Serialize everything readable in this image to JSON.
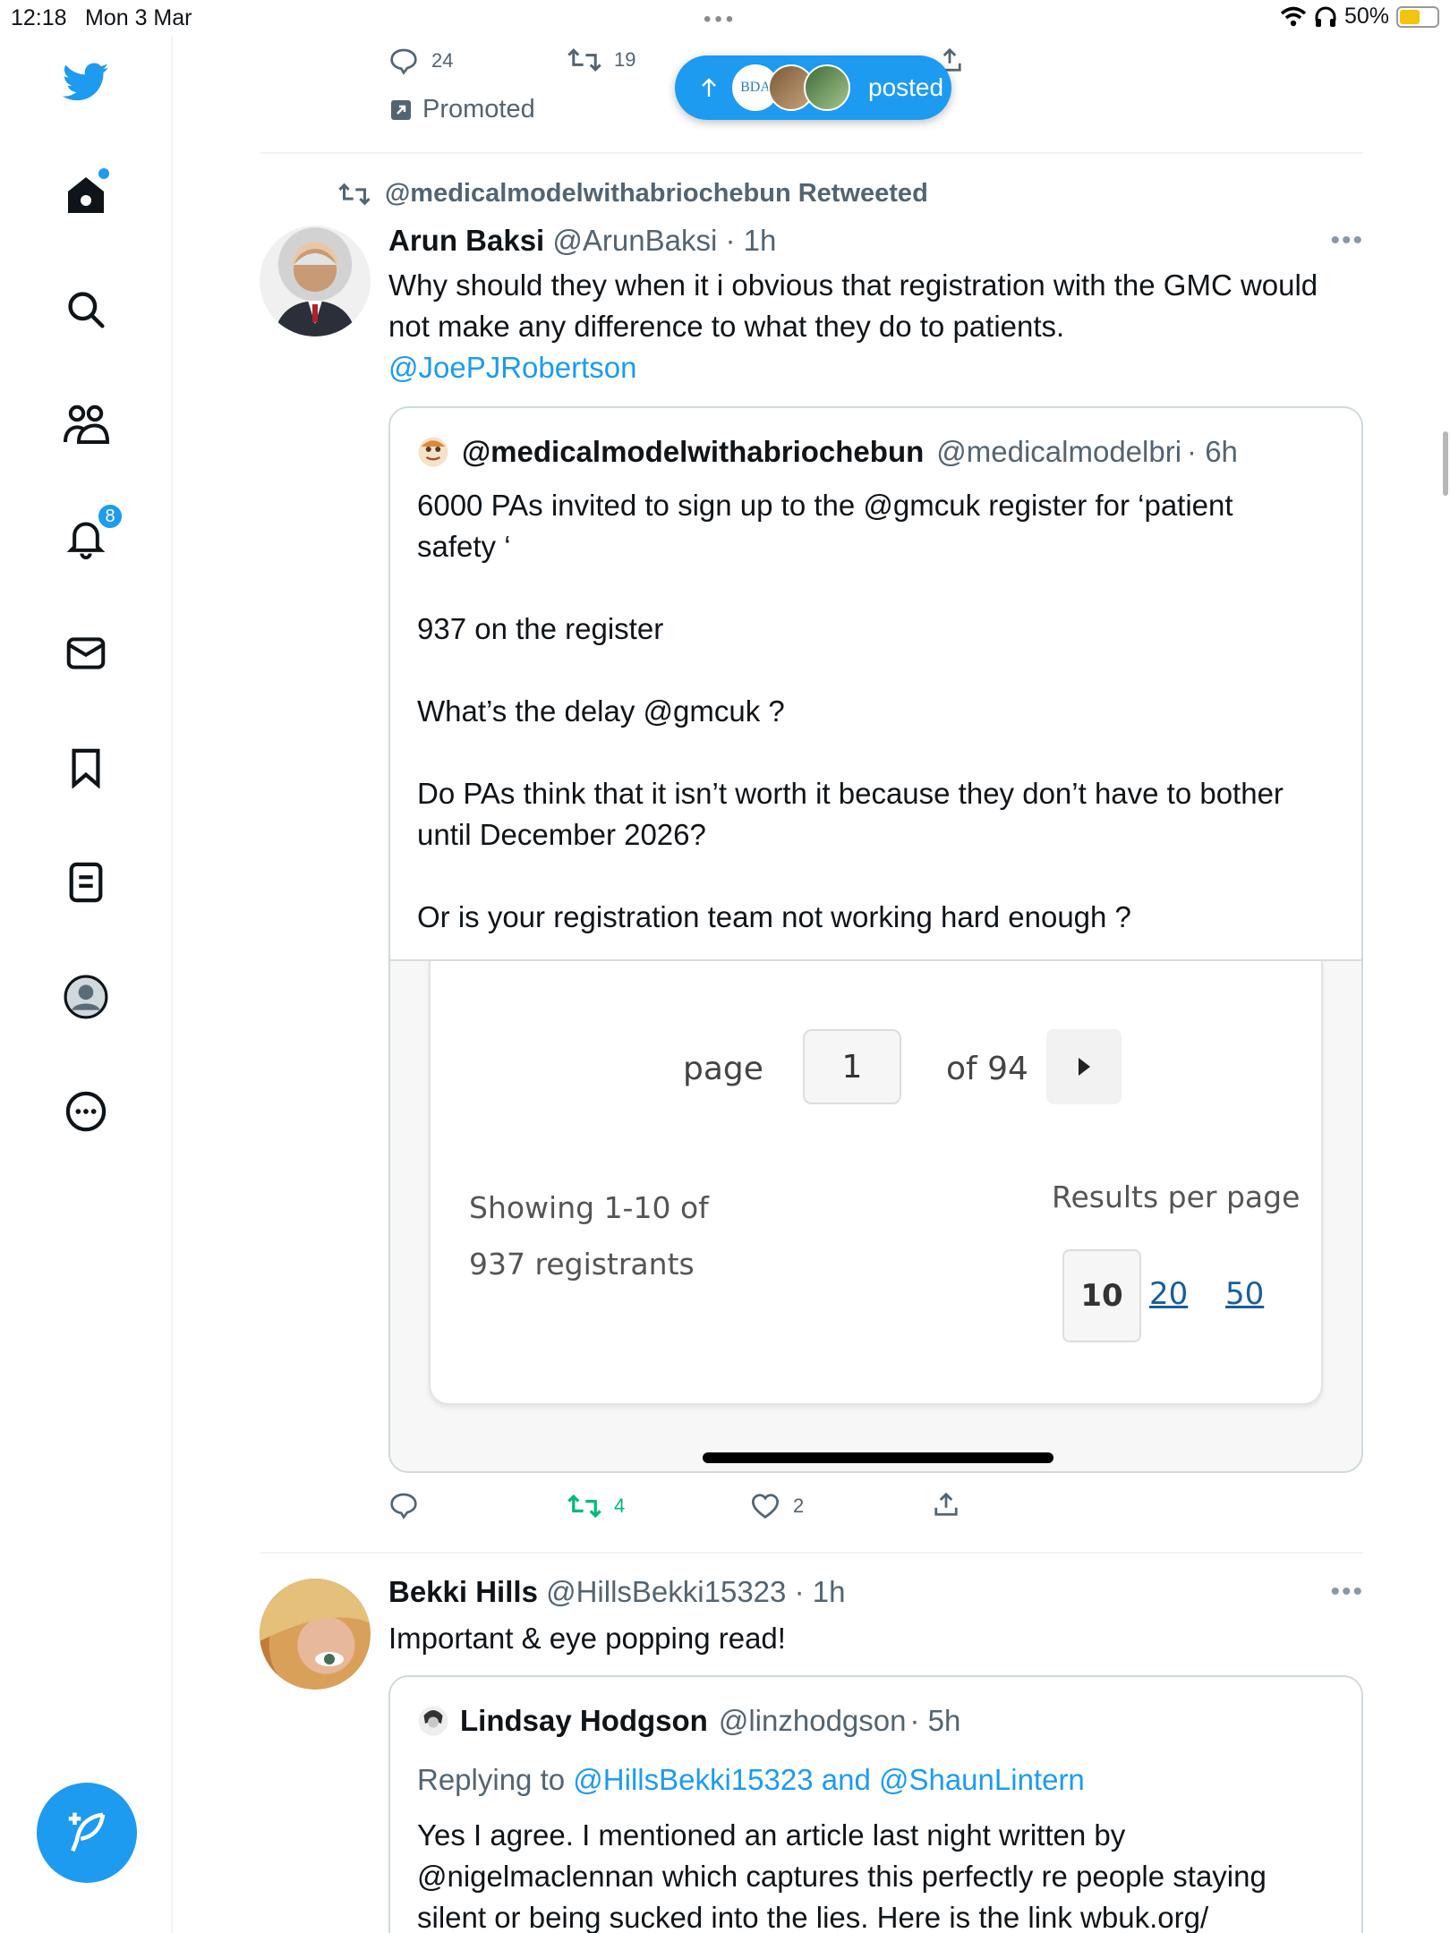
{
  "status_bar": {
    "time": "12:18",
    "date": "Mon 3 Mar",
    "battery": "50%"
  },
  "nav": {
    "notifications_badge": "8",
    "accent_color": "#1d9bf0"
  },
  "promoted_tweet": {
    "replies": "24",
    "retweets": "19",
    "promoted_label": "Promoted"
  },
  "new_posts_pill": {
    "avatar_text": "BDA",
    "label": "posted"
  },
  "tweet1": {
    "retweeted_by": "@medicalmodelwithabriochebun Retweeted",
    "name": "Arun Baksi",
    "handle": "@ArunBaksi",
    "time": "· 1h",
    "text_line1": "Why should they when it i obvious that registration with the GMC would",
    "text_line2": "not make any difference to what they do to patients.",
    "mention": "@JoePJRobertson",
    "quote": {
      "name": "@medicalmodelwithabriochebun",
      "handle": "@medicalmodelbri",
      "time": "· 6h",
      "p1a": "6000 PAs invited to sign up to the @gmcuk register for ‘patient",
      "p1b": "safety ‘",
      "p2": "937 on the register",
      "p3": "What’s the delay @gmcuk ?",
      "p4a": "Do PAs think that it isn’t worth it because they don’t have to bother",
      "p4b": "until December 2026?",
      "p5": "Or is your registration team not working hard enough ?",
      "image": {
        "page_label": "page",
        "page_value": "1",
        "of_label": "of 94",
        "showing_line1": "Showing 1-10 of",
        "showing_line2": "937 registrants",
        "results_per_page_label": "Results per page",
        "options": [
          "10",
          "20",
          "50"
        ],
        "selected": "10"
      }
    },
    "retweets": "4",
    "likes": "2"
  },
  "tweet2": {
    "name": "Bekki Hills",
    "handle": "@HillsBekki15323",
    "time": "· 1h",
    "text": "Important & eye popping read!",
    "quote": {
      "name": "Lindsay Hodgson",
      "handle": "@linzhodgson",
      "time": "· 5h",
      "replying_to_label": "Replying to",
      "replying_to_users": "@HillsBekki15323 and @ShaunLintern",
      "line1": "Yes I agree. I mentioned an article last night written by",
      "line2": "@nigelmaclennan which captures this perfectly re people staying",
      "line3": "silent or being sucked into the lies.  Here is the link wbuk.org/"
    }
  }
}
